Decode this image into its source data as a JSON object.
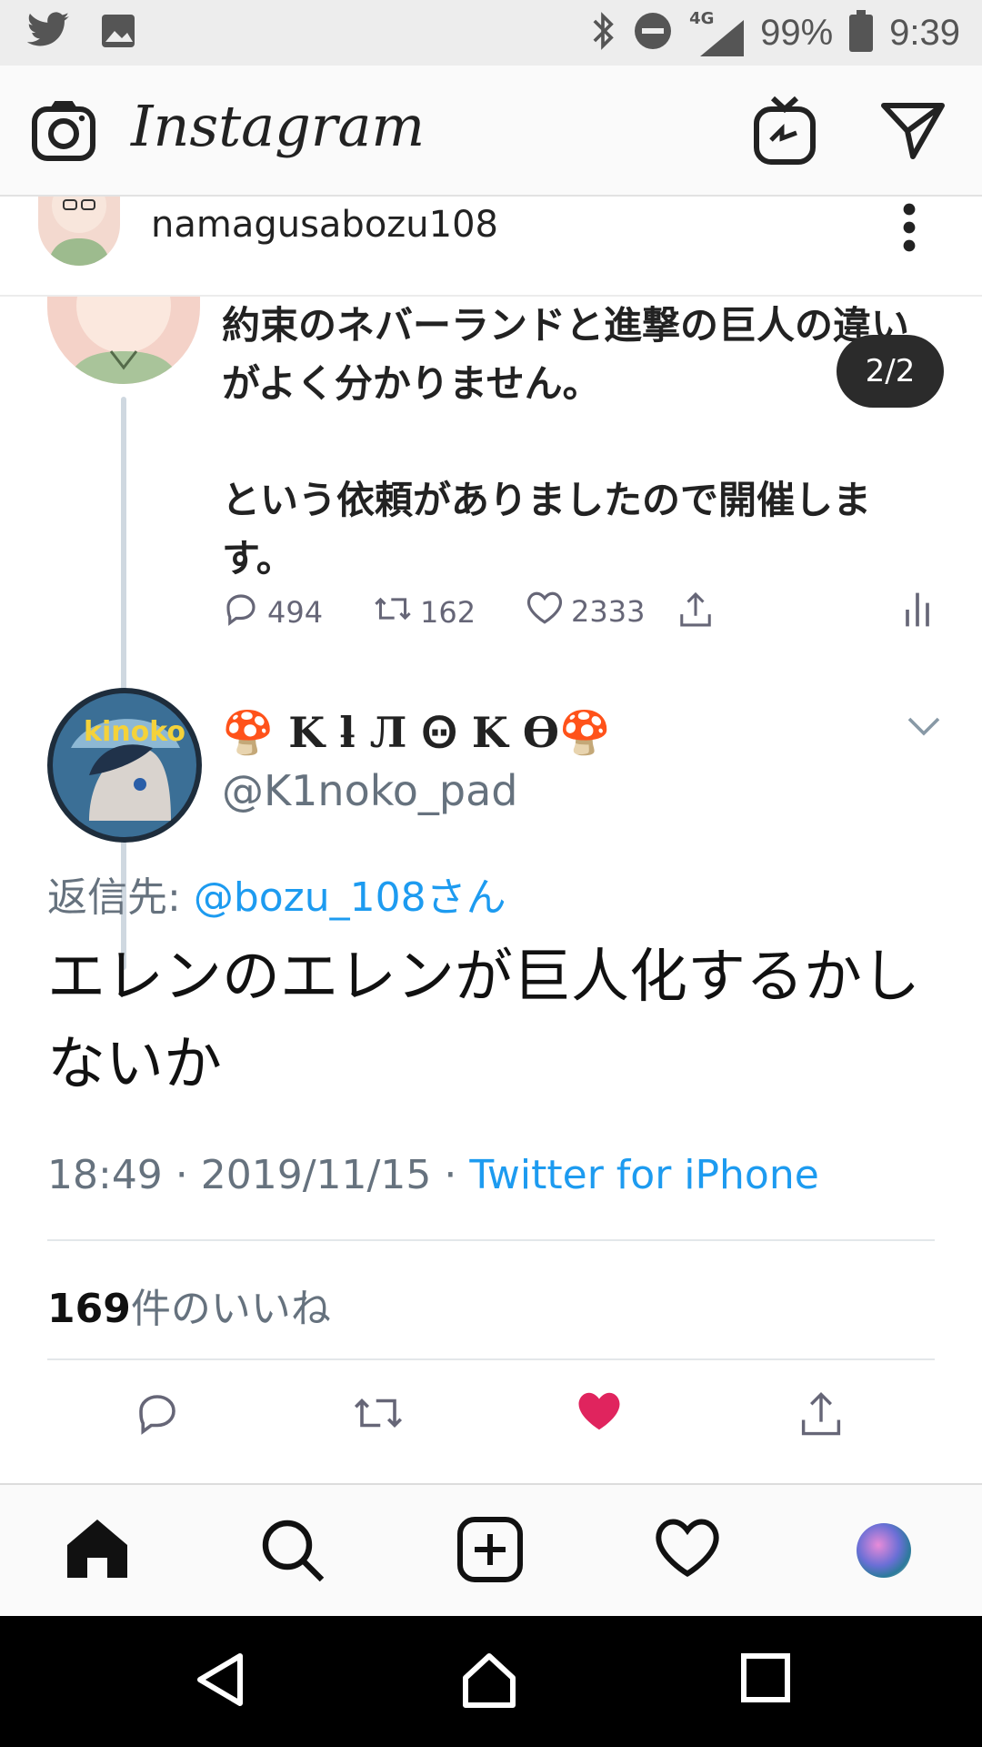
{
  "status_bar": {
    "network": "4G",
    "battery": "99%",
    "time": "9:39"
  },
  "ig_header": {
    "logo": "Instagram"
  },
  "post": {
    "username": "namagusabozu108"
  },
  "tweet_prev": {
    "line1": "約束のネバーランドと進撃の巨人の違いがよく分かりません。",
    "line2": "という依頼がありましたので開催します。",
    "page_indicator": "2/2",
    "reply_count": "494",
    "retweet_count": "162",
    "like_count": "2333"
  },
  "tweet": {
    "display_name": "🍄 K ƚ Л Ꙫ K Ө🍄",
    "handle": "@K1noko_pad",
    "reply_label": "返信先: ",
    "reply_link": "@bozu_108さん",
    "body": "エレンのエレンが巨人化するかしないか",
    "timestamp": "18:49 · 2019/11/15 · ",
    "source": "Twitter for iPhone",
    "likes_count": "169",
    "likes_label": "件のいいね",
    "liked_color": "#e0245e"
  }
}
